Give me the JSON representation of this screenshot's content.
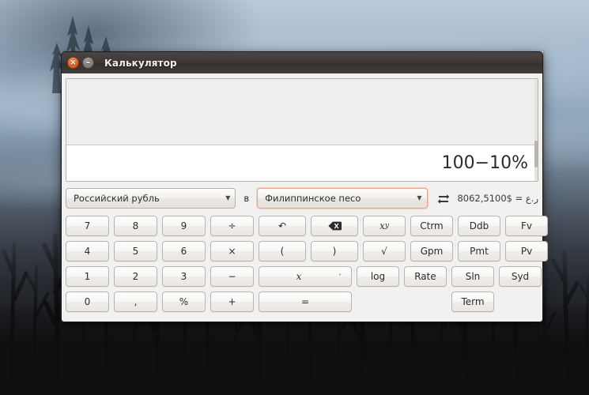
{
  "window": {
    "title": "Калькулятор",
    "close_glyph": "×",
    "minimize_glyph": "–",
    "close_name": "close",
    "minimize_name": "minimize"
  },
  "display": {
    "history": "",
    "value": "100−10%"
  },
  "currency": {
    "from": "Российский рубль",
    "to": "Филиппинское песо",
    "in_label": "в",
    "arrow_glyph": "▼",
    "swap_icon": "swap-arrows-icon",
    "rate": "8062,5ر.ع = $100"
  },
  "keypad": {
    "rows": [
      [
        {
          "label": "7",
          "name": "key-7",
          "width": "w1"
        },
        {
          "label": "8",
          "name": "key-8",
          "width": "w1"
        },
        {
          "label": "9",
          "name": "key-9",
          "width": "w1"
        },
        {
          "label": "÷",
          "name": "key-divide",
          "width": "w1"
        },
        {
          "label": "↶",
          "name": "key-undo",
          "width": "w-op"
        },
        {
          "label": "",
          "name": "key-backspace",
          "width": "w-op",
          "icon": "backspace-icon"
        },
        {
          "label": "x",
          "name": "key-power",
          "width": "w-sci",
          "sup": "y",
          "italic": true
        },
        {
          "label": "Ctrm",
          "name": "key-ctrm",
          "width": "w-fn"
        },
        {
          "label": "Ddb",
          "name": "key-ddb",
          "width": "w-fn"
        },
        {
          "label": "Fv",
          "name": "key-fv",
          "width": "w-fn"
        }
      ],
      [
        {
          "label": "4",
          "name": "key-4",
          "width": "w1"
        },
        {
          "label": "5",
          "name": "key-5",
          "width": "w1"
        },
        {
          "label": "6",
          "name": "key-6",
          "width": "w1"
        },
        {
          "label": "×",
          "name": "key-multiply",
          "width": "w1"
        },
        {
          "label": "(",
          "name": "key-paren-open",
          "width": "w-op"
        },
        {
          "label": ")",
          "name": "key-paren-close",
          "width": "w-op"
        },
        {
          "label": "√",
          "name": "key-sqrt",
          "width": "w-sci"
        },
        {
          "label": "Gpm",
          "name": "key-gpm",
          "width": "w-fn"
        },
        {
          "label": "Pmt",
          "name": "key-pmt",
          "width": "w-fn"
        },
        {
          "label": "Pv",
          "name": "key-pv",
          "width": "w-fn"
        }
      ],
      [
        {
          "label": "1",
          "name": "key-1",
          "width": "w1"
        },
        {
          "label": "2",
          "name": "key-2",
          "width": "w1"
        },
        {
          "label": "3",
          "name": "key-3",
          "width": "w1"
        },
        {
          "label": "−",
          "name": "key-subtract",
          "width": "w1"
        },
        {
          "label": "x",
          "name": "key-variable",
          "width": "w-wide",
          "italic": true,
          "chevron": "˅"
        },
        {
          "label": "log",
          "name": "key-log",
          "width": "w-sci"
        },
        {
          "label": "Rate",
          "name": "key-rate",
          "width": "w-fn"
        },
        {
          "label": "Sln",
          "name": "key-sln",
          "width": "w-fn"
        },
        {
          "label": "Syd",
          "name": "key-syd",
          "width": "w-fn"
        }
      ],
      [
        {
          "label": "0",
          "name": "key-0",
          "width": "w1"
        },
        {
          "label": ",",
          "name": "key-decimal",
          "width": "w1"
        },
        {
          "label": "%",
          "name": "key-percent",
          "width": "w1"
        },
        {
          "label": "+",
          "name": "key-add",
          "width": "w1"
        },
        {
          "label": "=",
          "name": "key-equals",
          "width": "w-wide"
        },
        {
          "label": "",
          "name": "key-gap",
          "width": "w-sci",
          "spacer": true
        },
        {
          "label": "",
          "name": "key-gap2",
          "width": "w-fn",
          "spacer": true
        },
        {
          "label": "Term",
          "name": "key-term",
          "width": "w-fn"
        }
      ]
    ]
  }
}
